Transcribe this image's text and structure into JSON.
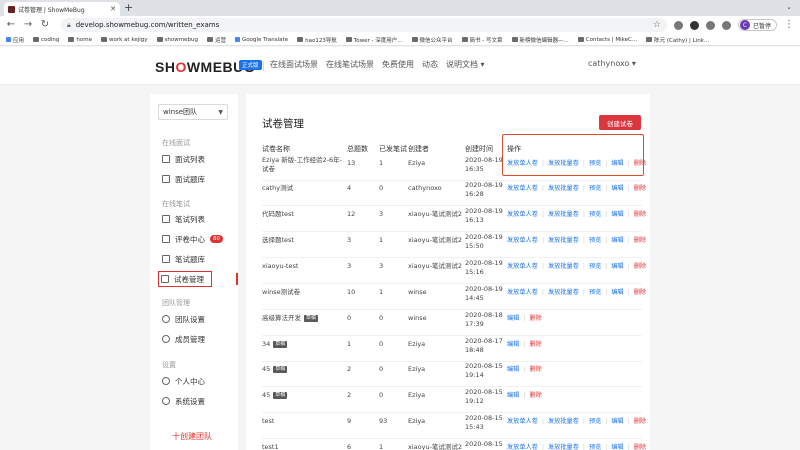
{
  "browser": {
    "tab_title": "试卷管理 | ShowMeBug",
    "url": "develop.showmebug.com/written_exams",
    "profile_status": "已暂停",
    "profile_initial": "C"
  },
  "bookmarks": [
    "应用",
    "coding",
    "home",
    "work at kejigy",
    "showmebug",
    "运营",
    "Google Translate",
    "hao123导航",
    "Tower - 深度用户...",
    "微信公众平台",
    "简书 - 写文章",
    "新榜微信编辑器—...",
    "Contacts | MikeC...",
    "陈元 (Cathy) | Link..."
  ],
  "header": {
    "logo_text": "SHOWMEBUG",
    "edition": "正式版",
    "nav": [
      "在线面试场景",
      "在线笔试场景",
      "免费使用",
      "动态",
      "说明文档"
    ],
    "user": "cathynoxo"
  },
  "sidebar": {
    "team": "winse团队",
    "sections": {
      "interview": "在线面试",
      "written": "在线笔试",
      "team": "团队管理",
      "settings": "设置"
    },
    "items": {
      "interview_list": "面试列表",
      "interview_bank": "面试题库",
      "written_list": "笔试列表",
      "review_center": "评卷中心",
      "review_badge": "80",
      "written_bank": "笔试题库",
      "paper_manage": "试卷管理",
      "team_settings": "团队设置",
      "member_manage": "成员管理",
      "personal_center": "个人中心",
      "system_settings": "系统设置"
    },
    "create_team": "十创建团队"
  },
  "main": {
    "title": "试卷管理",
    "create_button": "创建试卷",
    "headers": {
      "name": "试卷名称",
      "questions": "总题数",
      "sent": "已发笔试",
      "creator": "创建者",
      "created_at": "创建时间",
      "ops": "操作"
    },
    "op_labels": {
      "single": "发放单人卷",
      "batch": "发放批量卷",
      "preview": "预览",
      "edit": "编辑",
      "delete": "删除"
    },
    "draft_tag": "草稿",
    "rows": [
      {
        "name": "Eziya 新版-工作经验2-6年-试卷",
        "questions": "13",
        "sent": "1",
        "creator": "Eziya",
        "date": "2020-08-19",
        "time": "16:35"
      },
      {
        "name": "cathy测试",
        "questions": "4",
        "sent": "0",
        "creator": "cathynoxo",
        "date": "2020-08-19",
        "time": "16:28"
      },
      {
        "name": "代码题test",
        "questions": "12",
        "sent": "3",
        "creator": "xiaoyu-笔试测试2",
        "date": "2020-08-19",
        "time": "16:13"
      },
      {
        "name": "选择题test",
        "questions": "3",
        "sent": "1",
        "creator": "xiaoyu-笔试测试2",
        "date": "2020-08-19",
        "time": "15:50"
      },
      {
        "name": "xiaoyu-test",
        "questions": "3",
        "sent": "3",
        "creator": "xiaoyu-笔试测试2",
        "date": "2020-08-19",
        "time": "15:16"
      },
      {
        "name": "winse测试卷",
        "questions": "10",
        "sent": "1",
        "creator": "winse",
        "date": "2020-08-19",
        "time": "14:45"
      },
      {
        "name": "高级算法开发",
        "questions": "0",
        "sent": "0",
        "creator": "winse",
        "date": "2020-08-18",
        "time": "17:39"
      },
      {
        "name": "34",
        "questions": "1",
        "sent": "0",
        "creator": "Eziya",
        "date": "2020-08-17",
        "time": "18:48"
      },
      {
        "name": "45",
        "questions": "2",
        "sent": "0",
        "creator": "Eziya",
        "date": "2020-08-15",
        "time": "19:14"
      },
      {
        "name": "45",
        "questions": "2",
        "sent": "0",
        "creator": "Eziya",
        "date": "2020-08-15",
        "time": "19:12"
      },
      {
        "name": "test",
        "questions": "9",
        "sent": "93",
        "creator": "Eziya",
        "date": "2020-08-15",
        "time": "15:43"
      },
      {
        "name": "test1",
        "questions": "6",
        "sent": "1",
        "creator": "xiaoyu-笔试测试2",
        "date": "2020-08-15",
        "time": ""
      }
    ]
  }
}
